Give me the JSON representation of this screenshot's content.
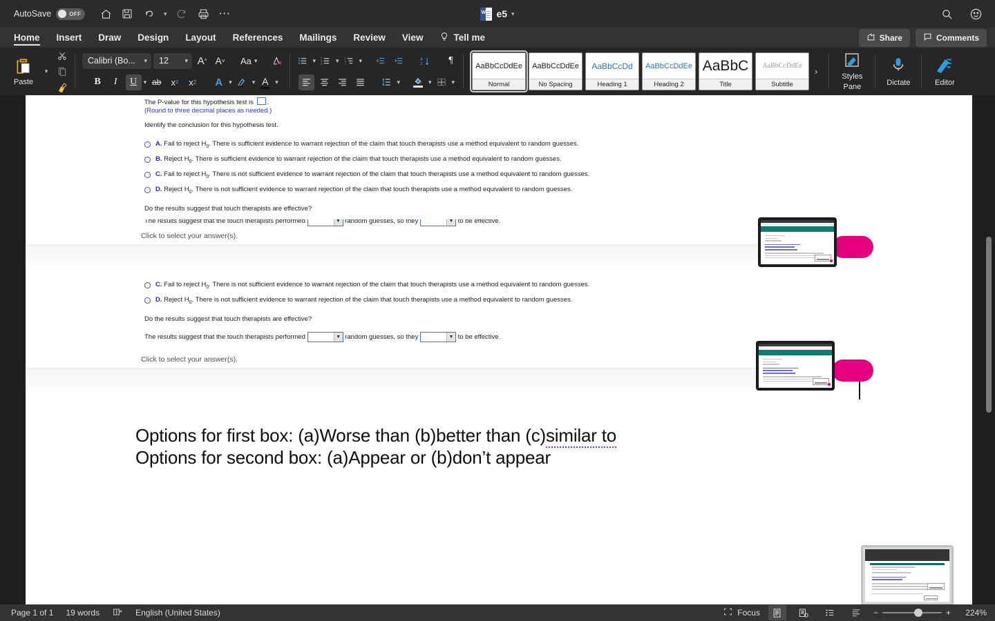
{
  "titlebar": {
    "autosave_label": "AutoSave",
    "autosave_state": "OFF",
    "icons": [
      "home-icon",
      "save-icon",
      "undo-icon",
      "redo-icon",
      "print-icon",
      "more-icon"
    ],
    "doc_title": "e5",
    "search_icon": "search-icon",
    "account_icon": "account-icon"
  },
  "tabs": {
    "items": [
      {
        "label": "Home",
        "active": true
      },
      {
        "label": "Insert",
        "active": false
      },
      {
        "label": "Draw",
        "active": false
      },
      {
        "label": "Design",
        "active": false
      },
      {
        "label": "Layout",
        "active": false
      },
      {
        "label": "References",
        "active": false
      },
      {
        "label": "Mailings",
        "active": false
      },
      {
        "label": "Review",
        "active": false
      },
      {
        "label": "View",
        "active": false
      }
    ],
    "tell_me": "Tell me",
    "share": "Share",
    "comments": "Comments"
  },
  "ribbon": {
    "paste_label": "Paste",
    "font_name": "Calibri (Bo...",
    "font_size": "12",
    "grow_font": "A",
    "shrink_font": "A",
    "change_case": "Aa",
    "clear_formatting": "clear-formatting-icon",
    "bold": "B",
    "italic": "I",
    "underline": "U",
    "strikethrough": "ab",
    "subscript": "x",
    "superscript": "x",
    "text_effects": "A",
    "highlight": "A",
    "font_color": "A",
    "styles": [
      {
        "preview": "AaBbCcDdEe",
        "name": "Normal",
        "kind": "normal",
        "selected": true
      },
      {
        "preview": "AaBbCcDdEe",
        "name": "No Spacing",
        "kind": "ns",
        "selected": false
      },
      {
        "preview": "AaBbCcDd",
        "name": "Heading 1",
        "kind": "h1",
        "selected": false
      },
      {
        "preview": "AaBbCcDdEe",
        "name": "Heading 2",
        "kind": "h2",
        "selected": false
      },
      {
        "preview": "AaBbC",
        "name": "Title",
        "kind": "title",
        "selected": false
      },
      {
        "preview": "AaBbCcDdEe",
        "name": "Subtitle",
        "kind": "sub",
        "selected": false
      }
    ],
    "gallery_more": "›",
    "styles_pane": "Styles\nPane",
    "styles_pane_l1": "Styles",
    "styles_pane_l2": "Pane",
    "dictate": "Dictate",
    "editor": "Editor"
  },
  "document": {
    "block1": {
      "pvalue_line": "The P-value for this hypothesis test is",
      "pvalue_period": ".",
      "round_note": "(Round to three decimal places as needed.)",
      "identify_line": "Identify the conclusion for this hypothesis test.",
      "options": [
        {
          "letter": "A.",
          "text_pre": "Fail to reject H",
          "sub": "0",
          "text_post": ". There is sufficient evidence to warrant rejection of the claim that touch therapists use a method equivalent to random guesses."
        },
        {
          "letter": "B.",
          "text_pre": "Reject H",
          "sub": "0",
          "text_post": ". There is sufficient evidence to warrant rejection of the claim that touch therapists use a method equivalent to random guesses."
        },
        {
          "letter": "C.",
          "text_pre": "Fail to reject H",
          "sub": "0",
          "text_post": ". There is not sufficient evidence to warrant rejection of the claim that touch therapists use a method equivalent to random guesses."
        },
        {
          "letter": "D.",
          "text_pre": "Reject H",
          "sub": "0",
          "text_post": ". There is not sufficient evidence to warrant rejection of the claim that touch therapists use a method equivalent to random guesses."
        }
      ],
      "effective_q": "Do the results suggest that touch therapists are effective?",
      "click_select": "Click to select your answer(s)."
    },
    "block2": {
      "options": [
        {
          "letter": "C.",
          "text_pre": "Fail to reject H",
          "sub": "0",
          "text_post": ". There is not sufficient evidence to warrant rejection of the claim that touch therapists use a method equivalent to random guesses."
        },
        {
          "letter": "D.",
          "text_pre": "Reject H",
          "sub": "0",
          "text_post": ". There is not sufficient evidence to warrant rejection of the claim that touch therapists use a method equivalent to random guesses."
        }
      ],
      "effective_q": "Do the results suggest that touch therapists are effective?",
      "fill_pre": "The results suggest that the touch therapists performed",
      "fill_mid": "random guesses, so they",
      "fill_post": "to be effective.",
      "dropdown1_value": "",
      "dropdown2_value": "",
      "click_select": "Click to select your answer(s)."
    },
    "typed": {
      "line1_pre": "Options for first box: (a)Worse than (b)better than (c)",
      "line1_flagged": "similar to",
      "line2": "Options for second box: (a)Appear or (b)don’t appear"
    }
  },
  "statusbar": {
    "page": "Page 1 of 1",
    "words": "19 words",
    "proofing_icon": "proofing-errors-icon",
    "language": "English (United States)",
    "focus": "Focus",
    "views": [
      "print-layout-icon",
      "web-layout-icon",
      "outline-icon",
      "draft-icon"
    ],
    "zoom_out": "−",
    "zoom_in": "+",
    "zoom_level": "224%"
  }
}
